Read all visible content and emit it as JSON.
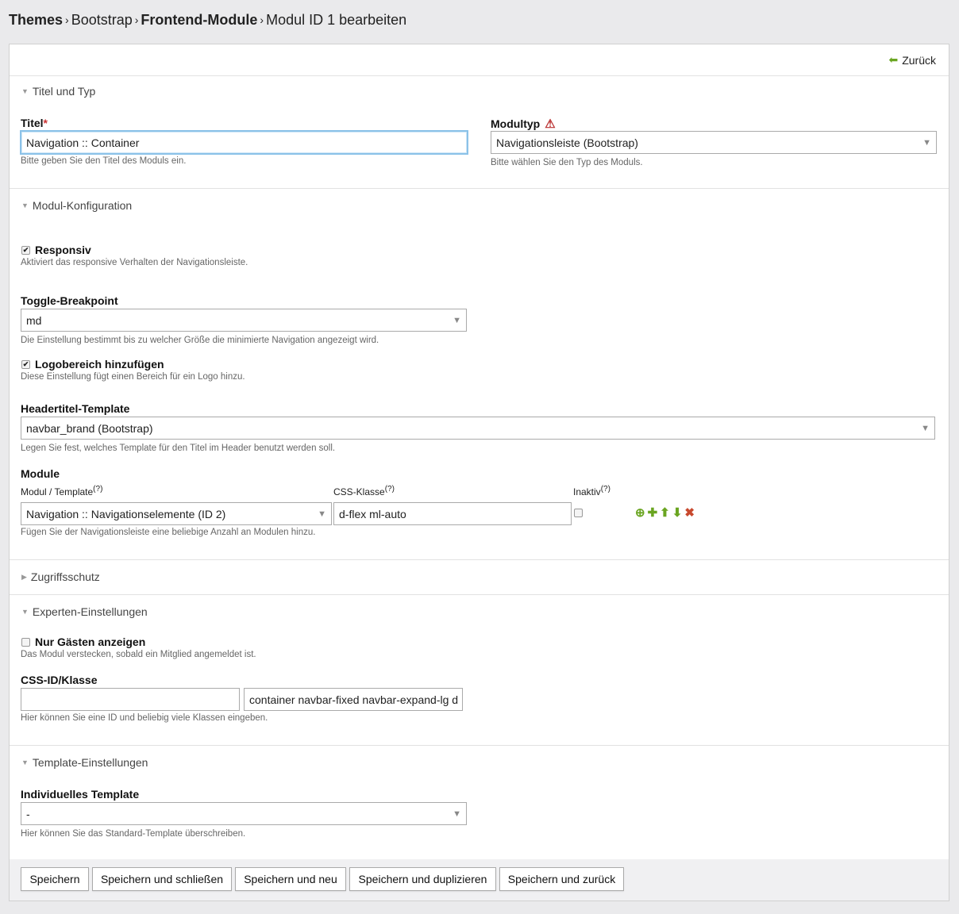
{
  "breadcrumb": {
    "item1": "Themes",
    "item2": "Bootstrap",
    "item3": "Frontend-Module",
    "item4": "Modul ID 1 bearbeiten",
    "separator": "›"
  },
  "back_label": "Zurück",
  "sections": {
    "titel_typ": "Titel und Typ",
    "modul_konfig": "Modul-Konfiguration",
    "zugriff": "Zugriffsschutz",
    "experten": "Experten-Einstellungen",
    "template": "Template-Einstellungen"
  },
  "titel": {
    "label": "Titel",
    "required": "*",
    "value": "Navigation :: Container",
    "help": "Bitte geben Sie den Titel des Moduls ein."
  },
  "modultyp": {
    "label": "Modultyp",
    "value": "Navigationsleiste (Bootstrap)",
    "help": "Bitte wählen Sie den Typ des Moduls."
  },
  "responsiv": {
    "label": "Responsiv",
    "checked": "✔",
    "help": "Aktiviert das responsive Verhalten der Navigationsleiste."
  },
  "breakpoint": {
    "label": "Toggle-Breakpoint",
    "value": "md",
    "help": "Die Einstellung bestimmt bis zu welcher Größe die minimierte Navigation angezeigt wird."
  },
  "logo": {
    "label": "Logobereich hinzufügen",
    "checked": "✔",
    "help": "Diese Einstellung fügt einen Bereich für ein Logo hinzu."
  },
  "headertitel": {
    "label": "Headertitel-Template",
    "value": "navbar_brand (Bootstrap)",
    "help": "Legen Sie fest, welches Template für den Titel im Header benutzt werden soll."
  },
  "module": {
    "label": "Module",
    "col1": "Modul / Template",
    "col2": "CSS-Klasse",
    "col3": "Inaktiv",
    "hint": "(?)",
    "row_template": "Navigation :: Navigationselemente (ID 2)",
    "row_css": "d-flex ml-auto",
    "help": "Fügen Sie der Navigationsleiste eine beliebige Anzahl an Modulen hinzu."
  },
  "gaeste": {
    "label": "Nur Gästen anzeigen",
    "help": "Das Modul verstecken, sobald ein Mitglied angemeldet ist."
  },
  "cssid": {
    "label": "CSS-ID/Klasse",
    "id_value": "",
    "class_value": "container navbar-fixed navbar-expand-lg d",
    "help": "Hier können Sie eine ID und beliebig viele Klassen eingeben."
  },
  "indiv_template": {
    "label": "Individuelles Template",
    "value": "-",
    "help": "Hier können Sie das Standard-Template überschreiben."
  },
  "buttons": {
    "save": "Speichern",
    "save_close": "Speichern und schließen",
    "save_new": "Speichern und neu",
    "save_duplicate": "Speichern und duplizieren",
    "save_back": "Speichern und zurück"
  },
  "icons": {
    "triangle_open": "▼",
    "triangle_closed": "▶",
    "select_arrow": "▼",
    "back_arrow": "⬅",
    "warning": "⚠",
    "copy": "⊕",
    "add": "✚",
    "up": "⬆",
    "down": "⬇",
    "delete": "✖"
  },
  "colors": {
    "accent_green": "#6aa521",
    "delete_red": "#c8492e",
    "focus_blue": "#8bc2e8"
  }
}
